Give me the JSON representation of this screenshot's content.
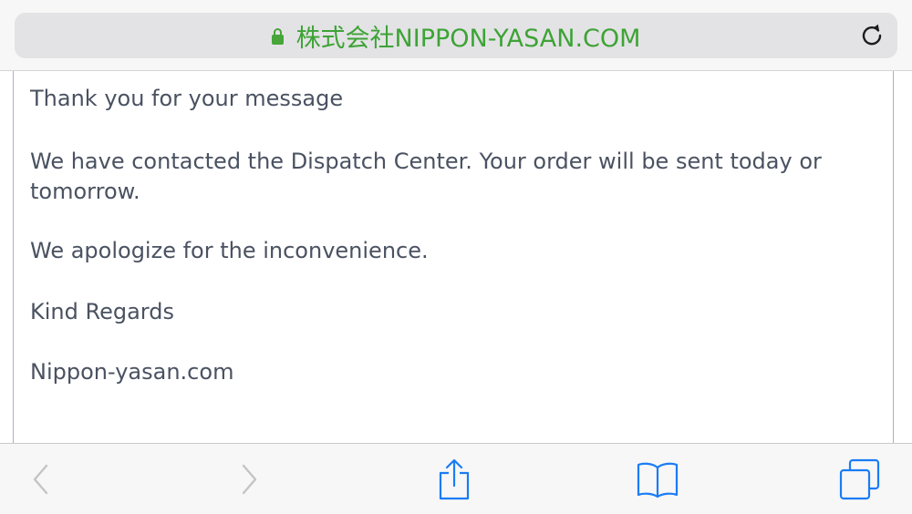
{
  "address_bar": {
    "url_text": "株式会社NIPPON-YASAN.COM",
    "secure_color": "#3ea336",
    "lock_icon": "lock-icon",
    "reload_icon": "reload-icon"
  },
  "message": {
    "line1": "Thank you for your message",
    "line2": "We have contacted the Dispatch Center. Your order will be sent today or tomorrow.",
    "line3": "We apologize for the inconvenience.",
    "line4": "Kind Regards",
    "line5": "Nippon-yasan.com"
  },
  "toolbar": {
    "icons": [
      "back-icon",
      "forward-icon",
      "share-icon",
      "bookmarks-icon",
      "tabs-icon"
    ],
    "accent_color": "#1a7cf5",
    "disabled_color": "#c4c4c8"
  }
}
